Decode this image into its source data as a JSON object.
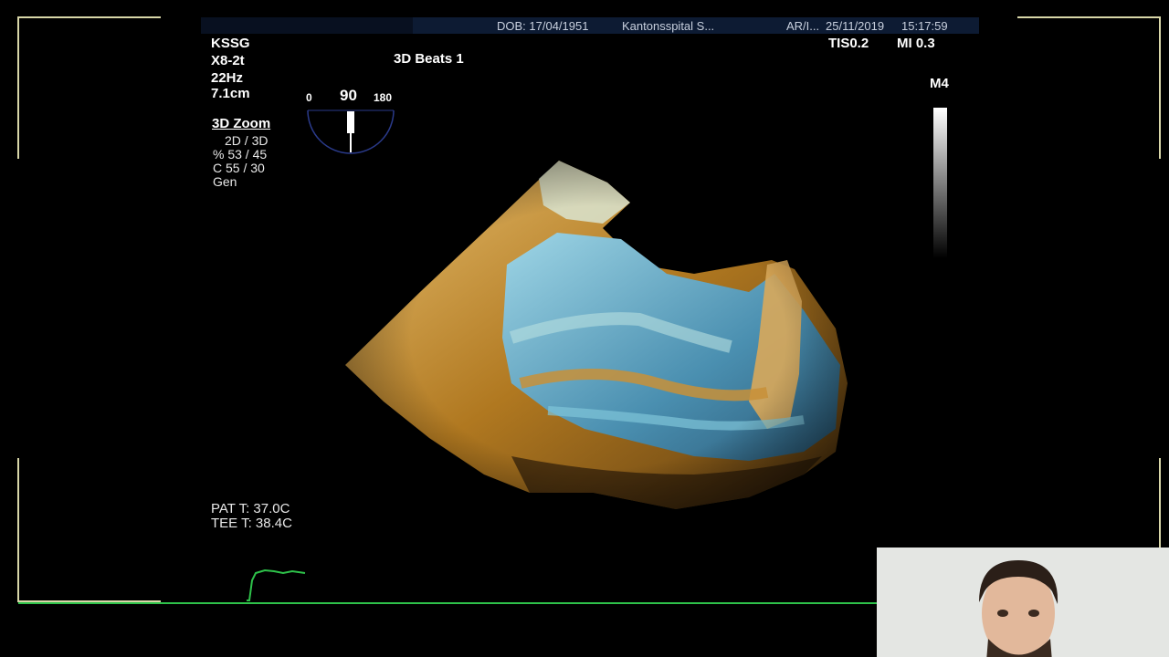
{
  "header": {
    "dob": "DOB: 17/04/1951",
    "hospital": "Kantonsspital S...",
    "ar": "AR/I...",
    "date": "25/11/2019",
    "time": "15:17:59"
  },
  "indices": {
    "tis": "TIS0.2",
    "mi": "MI 0.3"
  },
  "map_label": "M4",
  "probe_info": {
    "site": "KSSG",
    "probe": "X8-2t",
    "rate": "22Hz",
    "depth": "7.1cm"
  },
  "angle": {
    "min": "0",
    "value": "90",
    "max": "180"
  },
  "mode_title": "3D Beats 1",
  "zoom_panel": {
    "title": "3D Zoom",
    "line1": "2D / 3D",
    "line2": "% 53 / 45",
    "line3": "C  55 / 30",
    "line4": "Gen"
  },
  "temps": {
    "patient": "PAT T: 37.0C",
    "tee": "TEE T: 38.4C"
  },
  "colors": {
    "frame": "#d8d6a8",
    "ecg": "#2ec24a",
    "header": "#0d1b33",
    "gold": "#c88a2a",
    "teal": "#5aa3c4"
  }
}
